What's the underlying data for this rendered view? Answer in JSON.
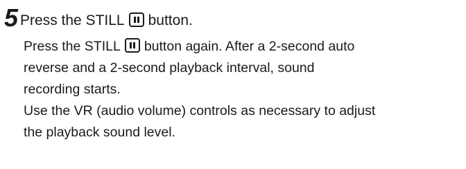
{
  "step": {
    "number": "5",
    "title_before": "Press the STILL",
    "title_after": "button.",
    "icon": "pause-icon"
  },
  "paragraphs": {
    "p1_before": "Press the STILL",
    "p1_after": "button again. After a 2-second auto",
    "p1_line2": "reverse and a 2-second playback interval, sound",
    "p1_line3": "recording starts.",
    "p2_line1": "Use the VR (audio volume) controls as necessary to adjust",
    "p2_line2": "the playback sound level."
  }
}
